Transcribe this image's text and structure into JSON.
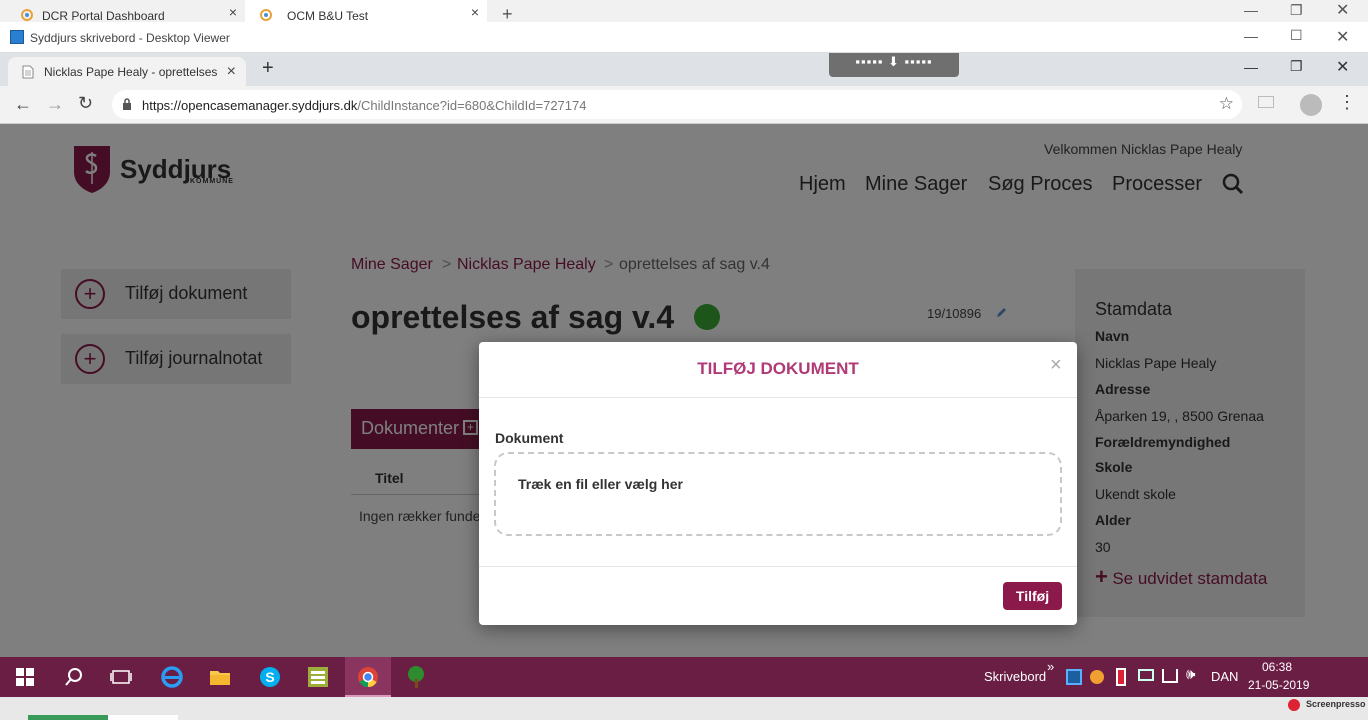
{
  "outer_tabs": [
    {
      "label": "DCR Portal Dashboard",
      "close": "×"
    },
    {
      "label": "OCM B&U Test",
      "close": "×"
    }
  ],
  "outer_new_tab": "+",
  "viewer_title": "Syddjurs skrivebord - Desktop Viewer",
  "browser_tab": {
    "label": "Nicklas Pape Healy - oprettelses",
    "close": "×"
  },
  "new_tab": "+",
  "url": {
    "host": "https://opencasemanager.syddjurs.dk",
    "path": "/ChildInstance?id=680&ChildId=727174"
  },
  "header": {
    "welcome": "Velkommen Nicklas Pape Healy",
    "logo_text": "Syddjurs",
    "logo_sub": "KOMMUNE"
  },
  "nav": [
    "Hjem",
    "Mine Sager",
    "Søg Proces",
    "Processer"
  ],
  "sidebar": {
    "add_document": "Tilføj dokument",
    "add_journal": "Tilføj journalnotat",
    "plus": "+"
  },
  "breadcrumb": {
    "root": "Mine Sager",
    "sep": ">",
    "person": "Nicklas Pape Healy",
    "current": "oprettelses af sag v.4"
  },
  "case": {
    "title": "oprettelses af sag v.4",
    "number": "19/10896",
    "status_color": "#3aaa35"
  },
  "documents": {
    "header": "Dokumenter",
    "col_title": "Titel",
    "empty": "Ingen rækker funde"
  },
  "stamdata": {
    "title": "Stamdata",
    "navn_label": "Navn",
    "navn": "Nicklas Pape Healy",
    "adresse_label": "Adresse",
    "adresse": "Åparken 19, , 8500 Grenaa",
    "foraeldre_label": "Forældremyndighed",
    "skole_label": "Skole",
    "skole": "Ukendt skole",
    "alder_label": "Alder",
    "alder": "30",
    "more": "Se udvidet stamdata",
    "more_plus": "+"
  },
  "modal": {
    "title": "TILFØJ DOKUMENT",
    "close": "×",
    "field_label": "Dokument",
    "dropzone": "Træk en fil eller vælg her",
    "submit": "Tilføj"
  },
  "taskbar": {
    "desktop_label": "Skrivebord",
    "chevron": "»",
    "lang": "DAN",
    "time": "06:38",
    "date": "21-05-2019"
  },
  "watermark": "Screenpresso",
  "colors": {
    "brand": "#8b1a4b",
    "taskbar": "#6b1e44",
    "status": "#3aaa35"
  }
}
